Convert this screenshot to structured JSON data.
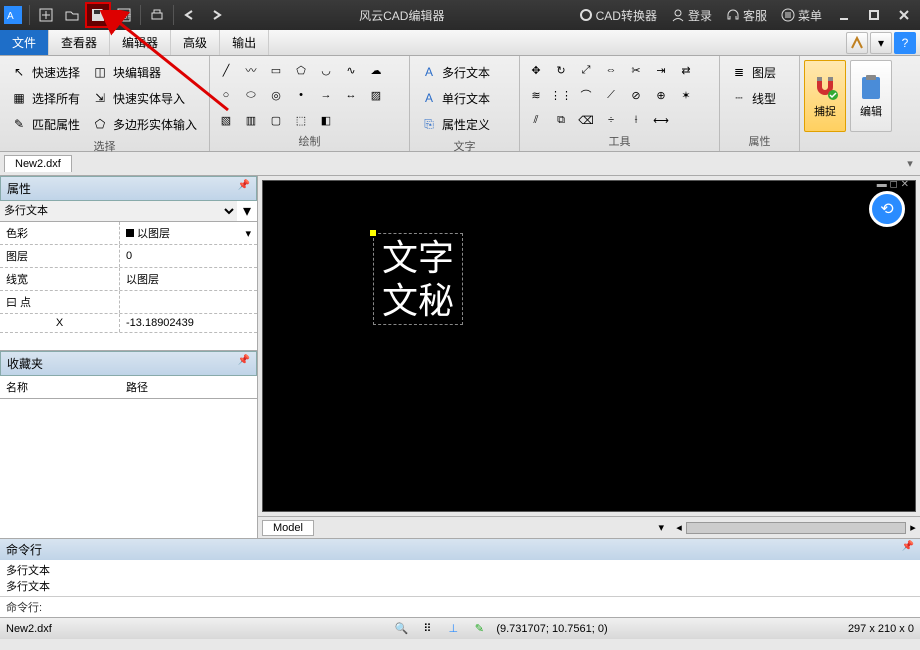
{
  "titlebar": {
    "app_title": "风云CAD编辑器",
    "converter": "CAD转换器",
    "login": "登录",
    "support": "客服",
    "menu": "菜单"
  },
  "menubar": {
    "items": [
      "文件",
      "查看器",
      "编辑器",
      "高级",
      "输出"
    ]
  },
  "ribbon": {
    "select": {
      "quick": "快速选择",
      "all": "选择所有",
      "match": "匹配属性",
      "block": "块编辑器",
      "fastimp": "快速实体导入",
      "polyimp": "多边形实体输入",
      "label": "选择"
    },
    "draw_label": "绘制",
    "text": {
      "mtext": "多行文本",
      "stext": "单行文本",
      "attdef": "属性定义",
      "label": "文字"
    },
    "tools_label": "工具",
    "props": {
      "layer": "图层",
      "ltype": "线型",
      "label": "属性"
    },
    "snap": "捕捉",
    "edit": "编辑"
  },
  "doctab": "New2.dxf",
  "panels": {
    "props_title": "属性",
    "object_type": "多行文本",
    "color_k": "色彩",
    "color_v": "以图层",
    "layer_k": "图层",
    "layer_v": "0",
    "lw_k": "线宽",
    "lw_v": "以图层",
    "pt_k": "曰 点",
    "x_k": "X",
    "x_v": "-13.18902439",
    "fav_title": "收藏夹",
    "fav_name": "名称",
    "fav_path": "路径"
  },
  "canvas": {
    "line1": "文字",
    "line2": "文秘"
  },
  "modeltab": "Model",
  "cmd": {
    "title": "命令行",
    "history1": "多行文本",
    "history2": "多行文本",
    "prompt": "命令行:"
  },
  "status": {
    "file": "New2.dxf",
    "coords": "(9.731707; 10.7561; 0)",
    "dims": "297 x 210 x 0"
  }
}
